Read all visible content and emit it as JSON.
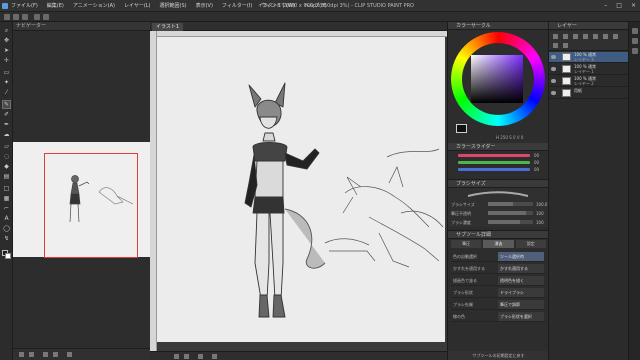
{
  "window": {
    "title": "イラスト1 (1600 x 900px 350dpi 3%) - CLIP STUDIO PAINT PRO",
    "controls": [
      "–",
      "□",
      "×"
    ]
  },
  "menu": [
    "ファイル(F)",
    "編集(E)",
    "アニメーション(A)",
    "レイヤー(L)",
    "選択範囲(S)",
    "表示(V)",
    "フィルター(I)",
    "ウィンドウ(W)",
    "ヘルプ(H)"
  ],
  "navigator": {
    "tab_label": "ナビゲーター"
  },
  "canvas": {
    "tab_label": "イラスト1"
  },
  "colors": {
    "accent": "#3f5c82",
    "nav_frame": "#e23b3b",
    "main_color": "#1a1a1a",
    "sub_color": "#ffffff",
    "slider_r": "#d94a6a",
    "slider_g": "#4fb54a",
    "slider_b": "#4a6fd9"
  },
  "color_panel": {
    "header": "カラーサークル",
    "readout": "H 250 S 0 V 0",
    "slider_header": "カラースライダー",
    "sliders": [
      {
        "name": "R",
        "value": "00"
      },
      {
        "name": "G",
        "value": "00"
      },
      {
        "name": "B",
        "value": "00"
      }
    ]
  },
  "brush_panel": {
    "header": "ブラシサイズ",
    "rows": [
      {
        "label": "ブラシサイズ",
        "value": "100.0",
        "level": 0.55
      },
      {
        "label": "筆圧不透明",
        "value": "100",
        "level": 0.85
      },
      {
        "label": "ブラシ濃度",
        "value": "100",
        "level": 0.7
      }
    ]
  },
  "tool_property": {
    "header": "サブツール詳細",
    "tabs": [
      "筆圧",
      "消去",
      "設定"
    ],
    "rows": [
      {
        "label": "色の自動選択",
        "value": "ツール選択時"
      },
      {
        "label": "かすれを適用する",
        "value": "かすれ適用する"
      },
      {
        "label": "描画色で塗る",
        "value": "透明色を描く"
      },
      {
        "label": "ブラシ形状",
        "value": "ドライブラシ"
      },
      {
        "label": "ブラシ先端",
        "value": "筆圧で調節"
      },
      {
        "label": "線の色",
        "value": "ブラシ形状を選択"
      }
    ],
    "footer": "サブツールの初期設定に戻す"
  },
  "layers": {
    "header": "レイヤー",
    "rows": [
      {
        "name": "100 % 通常",
        "mode": "レイヤー 3",
        "active": true
      },
      {
        "name": "100 % 通常",
        "mode": "レイヤー 1",
        "active": false
      },
      {
        "name": "100 % 通常",
        "mode": "レイヤー 2",
        "active": false
      },
      {
        "name": "用紙",
        "mode": "",
        "active": false
      }
    ]
  }
}
